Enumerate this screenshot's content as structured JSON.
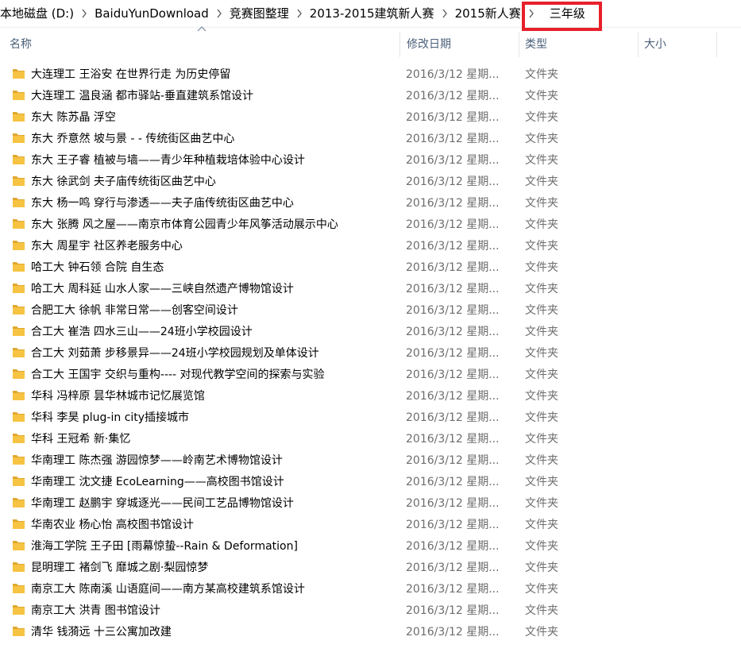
{
  "breadcrumb": {
    "items": [
      "本地磁盘 (D:)",
      "BaiduYunDownload",
      "竞赛图整理",
      "2013-2015建筑新人赛",
      "2015新人赛",
      "三年级"
    ],
    "highlight_color": "#e8202a"
  },
  "columns": {
    "name": "名称",
    "date": "修改日期",
    "type": "类型",
    "size": "大小",
    "sorted_by": "name",
    "sort_direction": "ascending"
  },
  "folder_color": "#f6c342",
  "files": [
    {
      "name": "大连理工 王浴安 在世界行走 为历史停留",
      "date": "2016/3/12 星期...",
      "type": "文件夹",
      "size": ""
    },
    {
      "name": "大连理工 温良涵 都市驿站-垂直建筑系馆设计",
      "date": "2016/3/12 星期...",
      "type": "文件夹",
      "size": ""
    },
    {
      "name": "东大 陈苏晶 浮空",
      "date": "2016/3/12 星期...",
      "type": "文件夹",
      "size": ""
    },
    {
      "name": "东大 乔意然 坡与景 - - 传统街区曲艺中心",
      "date": "2016/3/12 星期...",
      "type": "文件夹",
      "size": ""
    },
    {
      "name": "东大 王子睿 植被与墙——青少年种植栽培体验中心设计",
      "date": "2016/3/12 星期...",
      "type": "文件夹",
      "size": ""
    },
    {
      "name": "东大 徐武剑 夫子庙传统街区曲艺中心",
      "date": "2016/3/12 星期...",
      "type": "文件夹",
      "size": ""
    },
    {
      "name": "东大 杨一鸣 穿行与渗透——夫子庙传统街区曲艺中心",
      "date": "2016/3/12 星期...",
      "type": "文件夹",
      "size": ""
    },
    {
      "name": "东大 张腾 风之屋——南京市体育公园青少年风筝活动展示中心",
      "date": "2016/3/12 星期...",
      "type": "文件夹",
      "size": ""
    },
    {
      "name": "东大 周星宇 社区养老服务中心",
      "date": "2016/3/12 星期...",
      "type": "文件夹",
      "size": ""
    },
    {
      "name": "哈工大 钟石领 合院 自生态",
      "date": "2016/3/12 星期...",
      "type": "文件夹",
      "size": ""
    },
    {
      "name": "哈工大 周科延 山水人家——三峡自然遗产博物馆设计",
      "date": "2016/3/12 星期...",
      "type": "文件夹",
      "size": ""
    },
    {
      "name": "合肥工大 徐帆 非常日常——创客空间设计",
      "date": "2016/3/12 星期...",
      "type": "文件夹",
      "size": ""
    },
    {
      "name": "合工大 崔浩 四水三山——24班小学校园设计",
      "date": "2016/3/12 星期...",
      "type": "文件夹",
      "size": ""
    },
    {
      "name": "合工大 刘茹萧 步移景异——24班小学校园规划及单体设计",
      "date": "2016/3/12 星期...",
      "type": "文件夹",
      "size": ""
    },
    {
      "name": "合工大 王国宇 交织与重构---- 对现代教学空间的探索与实验",
      "date": "2016/3/12 星期...",
      "type": "文件夹",
      "size": ""
    },
    {
      "name": "华科 冯梓原 昙华林城市记忆展览馆",
      "date": "2016/3/12 星期...",
      "type": "文件夹",
      "size": ""
    },
    {
      "name": "华科 李昊 plug-in city插接城市",
      "date": "2016/3/12 星期...",
      "type": "文件夹",
      "size": ""
    },
    {
      "name": "华科 王冠希 新·集忆",
      "date": "2016/3/12 星期...",
      "type": "文件夹",
      "size": ""
    },
    {
      "name": "华南理工 陈杰强 游园惊梦——岭南艺术博物馆设计",
      "date": "2016/3/12 星期...",
      "type": "文件夹",
      "size": ""
    },
    {
      "name": "华南理工 沈文捷 EcoLearning——高校图书馆设计",
      "date": "2016/3/12 星期...",
      "type": "文件夹",
      "size": ""
    },
    {
      "name": "华南理工 赵鹏宇 穿城逐光——民间工艺品博物馆设计",
      "date": "2016/3/12 星期...",
      "type": "文件夹",
      "size": ""
    },
    {
      "name": "华南农业 杨心怡 高校图书馆设计",
      "date": "2016/3/12 星期...",
      "type": "文件夹",
      "size": ""
    },
    {
      "name": "淮海工学院 王子田 [雨幕惊蛰--Rain & Deformation]",
      "date": "2016/3/12 星期...",
      "type": "文件夹",
      "size": ""
    },
    {
      "name": "昆明理工 褚剑飞 靡城之剧·梨园惊梦",
      "date": "2016/3/12 星期...",
      "type": "文件夹",
      "size": ""
    },
    {
      "name": "南京工大 陈南溪 山语庭间——南方某高校建筑系馆设计",
      "date": "2016/3/12 星期...",
      "type": "文件夹",
      "size": ""
    },
    {
      "name": "南京工大 洪青 图书馆设计",
      "date": "2016/3/12 星期...",
      "type": "文件夹",
      "size": ""
    },
    {
      "name": "清华 钱漪远 十三公寓加改建",
      "date": "2016/3/12 星期...",
      "type": "文件夹",
      "size": ""
    }
  ]
}
